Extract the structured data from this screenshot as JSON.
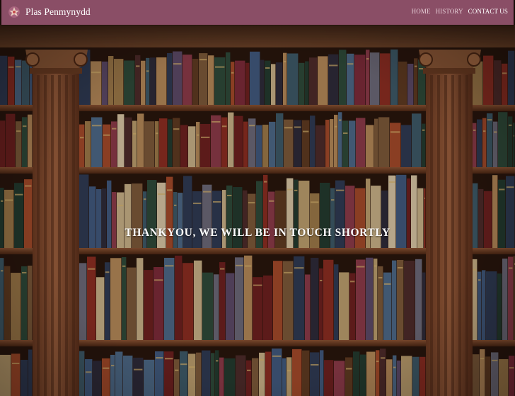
{
  "brand": {
    "name": "Plas Penmynydd",
    "logo_icon": "crest-icon"
  },
  "nav": {
    "items": [
      {
        "label": "HOME",
        "active": false
      },
      {
        "label": "HISTORY",
        "active": false
      },
      {
        "label": "CONTACT US",
        "active": true
      }
    ]
  },
  "hero": {
    "message": "THANKYOU, WE WILL BE IN TOUCH SHORTLY",
    "background": "library-bookshelf-photo"
  },
  "colors": {
    "navbar": "#8a4e66",
    "nav_link": "#e6cfd7",
    "nav_link_active": "#ffffff",
    "message_text": "#ffffff"
  }
}
